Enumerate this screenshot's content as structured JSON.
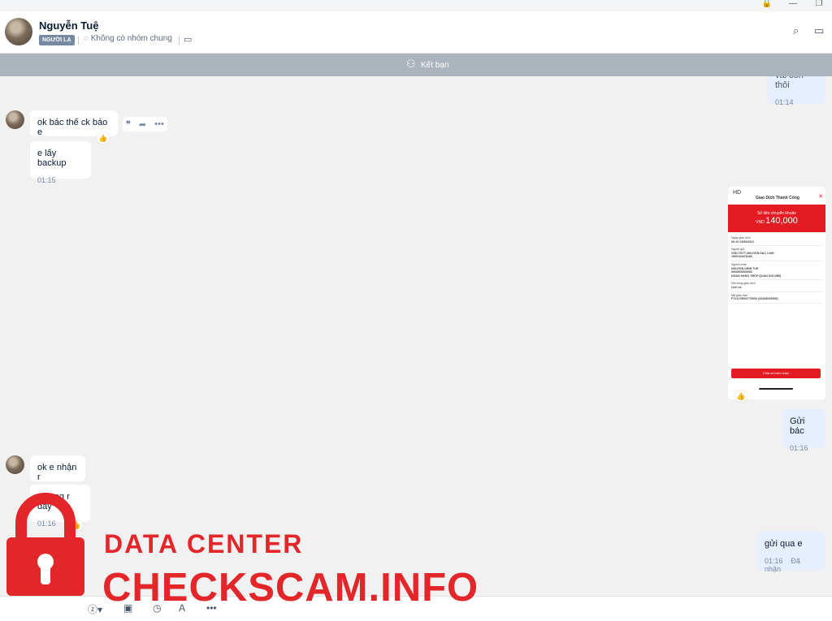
{
  "header": {
    "name": "Nguyễn Tuệ",
    "badge": "NGƯỜI LẠ",
    "group": "Không có nhóm chung",
    "add_friend": "Kết bạn"
  },
  "messages": {
    "m0_text": "vài còn thôi",
    "m0_time": "01:14",
    "m1_text": "ok bác thế ck báo e",
    "m2_text": "e lấy backup",
    "m2_time": "01:15",
    "m3_text": "Gửi bác",
    "m3_time": "01:16",
    "m4_text": "ok e nhận r",
    "m5_text": "e xong r đây",
    "m5_time": "01:16",
    "m6_text": "gửi qua e",
    "m6_time": "01:16",
    "m6_status": "Đã nhận"
  },
  "receipt": {
    "hd": "HD",
    "title": "Giao Dịch Thành Công",
    "amount_label": "Số tiền chuyển khoản",
    "currency": "VND",
    "amount": "140,000",
    "rows": [
      "Ngày giao dịch",
      "06:16 24/06/2021",
      "Người gửi",
      "VND-TKTT-NGUYEN DAC LINH",
      "1960104478180",
      "Người nhận",
      "NGUYEN DINH TUE",
      "6666666666666",
      "NGAN HANG TMCP QUAN DOI (MB)",
      "Nội dung giao dịch",
      "Linh ck",
      "Mã giao dịch",
      "FT21175003775903 (51683035559)"
    ],
    "button": "Chia sẻ biên nhận"
  },
  "watermark": {
    "line1": "DATA CENTER",
    "line2": "CHECKSCAM.INFO"
  },
  "colors": {
    "accent": "#0068ff",
    "brand_red": "#e3262a",
    "bubble_me": "#e5efff"
  }
}
